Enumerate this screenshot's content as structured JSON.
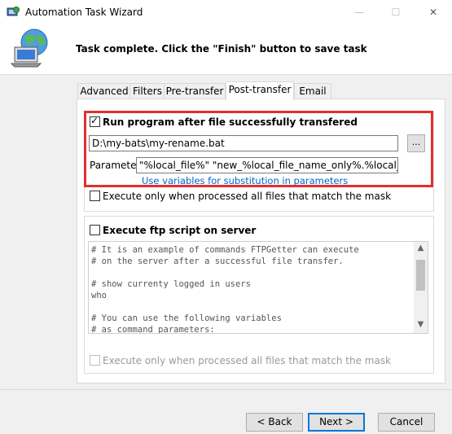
{
  "window": {
    "title": "Automation Task Wizard",
    "minimize_glyph": "—",
    "maximize_glyph": "☐",
    "close_glyph": "✕"
  },
  "header": {
    "message": "Task complete. Click the \"Finish\" button to save task",
    "icon": "globe-computer-icon"
  },
  "tabs": [
    {
      "label": "Advanced",
      "active": false
    },
    {
      "label": "Filters",
      "active": false
    },
    {
      "label": "Pre-transfer",
      "active": false
    },
    {
      "label": "Post-transfer",
      "active": true
    },
    {
      "label": "Email",
      "active": false
    }
  ],
  "run_program": {
    "checkbox_label": "Run program after file successfully transfered",
    "checked": true,
    "program_path": "D:\\my-bats\\my-rename.bat",
    "browse_label": "...",
    "parameters_label": "Parameters",
    "parameters_value": "\"%local_file%\" \"new_%local_file_name_only%.%local_file_na",
    "variables_link": "Use variables for substitution in parameters",
    "only_processed_label": "Execute only when processed all files that match the mask",
    "only_processed_checked": false
  },
  "ftp_script": {
    "checkbox_label": "Execute ftp script on server",
    "checked": false,
    "lines": [
      "# It is an example of commands FTPGetter can execute",
      "# on the server after a successful file transfer.",
      "",
      "# show currenty logged in users",
      "who",
      "",
      "# You can use the following variables",
      "# as command parameters:"
    ],
    "only_processed_label": "Execute only when processed all files that match the mask",
    "only_processed_checked": false
  },
  "buttons": {
    "back": "< Back",
    "next": "Next >",
    "cancel": "Cancel"
  },
  "colors": {
    "highlight": "#e52d2d",
    "link": "#0066cc",
    "default_button_border": "#0078d7"
  }
}
